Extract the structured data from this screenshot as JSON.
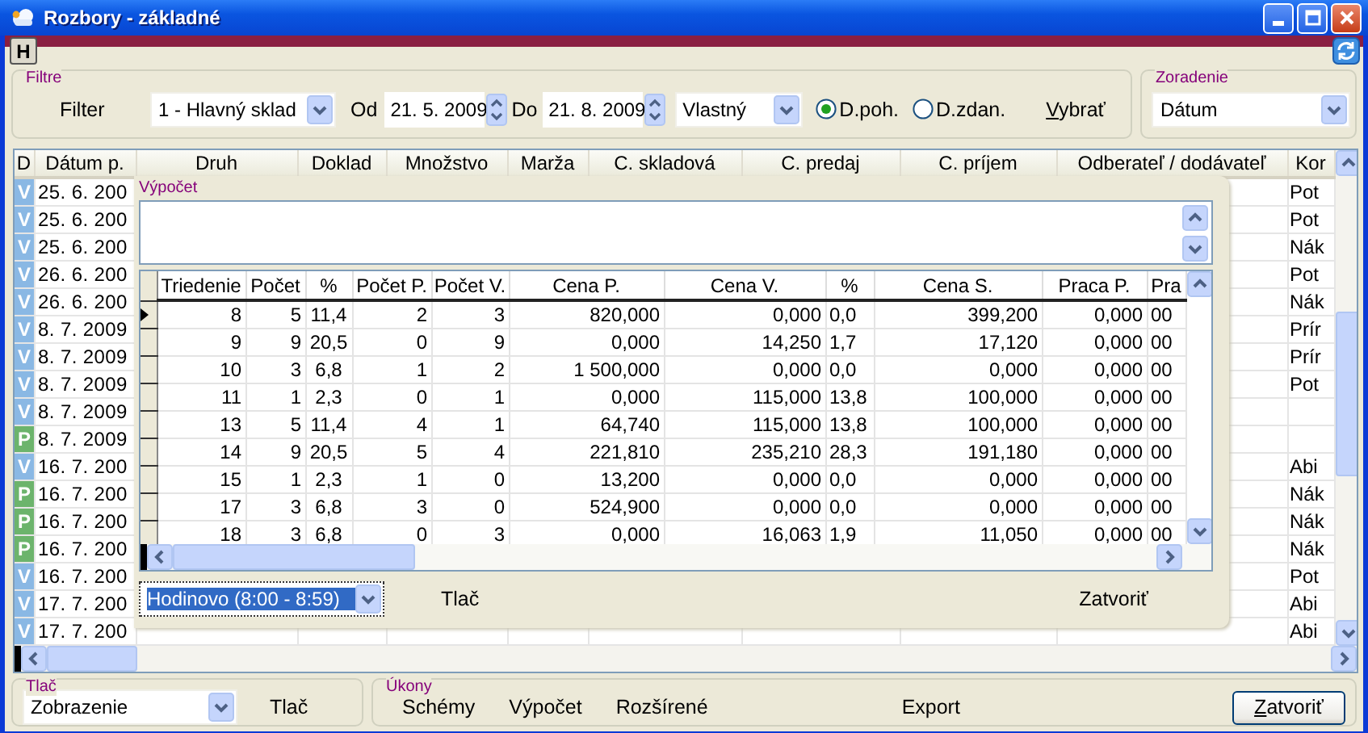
{
  "window": {
    "title": "Rozbory - základné"
  },
  "toolbar": {
    "button": "H"
  },
  "filter": {
    "group": "Filtre",
    "label": "Filter",
    "warehouse": "1 - Hlavný sklad",
    "from_label": "Od",
    "from": "21. 5. 2009",
    "to_label": "Do",
    "to": "21. 8. 2009",
    "period": "Vlastný",
    "date_options": [
      {
        "label": "D.poh.",
        "selected": true
      },
      {
        "label": "D.zdan.",
        "selected": false
      }
    ],
    "select_button": "Vybrať"
  },
  "sort": {
    "group": "Zoradenie",
    "value": "Dátum"
  },
  "grid": {
    "columns": [
      "D",
      "Dátum p.",
      "Druh",
      "Doklad",
      "Množstvo",
      "Marža",
      "C. skladová",
      "C. predaj",
      "C. príjem",
      "Odberateľ / dodávateľ",
      "Kor"
    ],
    "rows": [
      {
        "type": "V",
        "color": "#8ab8e4",
        "date": "25. 6. 200",
        "column_11": "Pot"
      },
      {
        "type": "V",
        "color": "#8ab8e4",
        "date": "25. 6. 200",
        "column_11": "Pot"
      },
      {
        "type": "V",
        "color": "#8ab8e4",
        "date": "25. 6. 200",
        "column_11": "Nák"
      },
      {
        "type": "V",
        "color": "#8ab8e4",
        "date": "26. 6. 200",
        "column_11": "Pot"
      },
      {
        "type": "V",
        "color": "#8ab8e4",
        "date": "26. 6. 200",
        "column_11": "Nák"
      },
      {
        "type": "V",
        "color": "#8ab8e4",
        "date": "8. 7. 2009",
        "column_11": "Prír"
      },
      {
        "type": "V",
        "color": "#8ab8e4",
        "date": "8. 7. 2009",
        "column_11": "Prír"
      },
      {
        "type": "V",
        "color": "#8ab8e4",
        "date": "8. 7. 2009",
        "column_11": "Pot"
      },
      {
        "type": "V",
        "color": "#8ab8e4",
        "date": "8. 7. 2009"
      },
      {
        "type": "P",
        "color": "#6cb46c",
        "date": "8. 7. 2009"
      },
      {
        "type": "V",
        "color": "#8ab8e4",
        "date": "16. 7. 200",
        "column_11": "Abi"
      },
      {
        "type": "P",
        "color": "#6cb46c",
        "date": "16. 7. 200",
        "column_11": "Nák"
      },
      {
        "type": "P",
        "color": "#6cb46c",
        "date": "16. 7. 200",
        "column_11": "Nák"
      },
      {
        "type": "P",
        "color": "#6cb46c",
        "date": "16. 7. 200",
        "column_11": "Nák"
      },
      {
        "type": "V",
        "color": "#8ab8e4",
        "date": "16. 7. 200",
        "column_11": "Pot"
      },
      {
        "type": "V",
        "color": "#8ab8e4",
        "date": "17. 7. 200",
        "column_11": "Abi"
      },
      {
        "type": "V",
        "color": "#8ab8e4",
        "date": "17. 7. 200",
        "column_11": "Abi"
      }
    ]
  },
  "calc": {
    "title": "Výpočet",
    "columns": [
      "Triedenie",
      "Počet",
      "%",
      "Počet P.",
      "Počet V.",
      "Cena P.",
      "Cena V.",
      "%",
      "Cena S.",
      "Praca P.",
      "Pra"
    ],
    "rows": [
      {
        "current": true,
        "cells": [
          "8",
          "5",
          "11,4",
          "2",
          "3",
          "820,000",
          "0,000",
          "0,0",
          "399,200",
          "0,000",
          "00"
        ]
      },
      {
        "current": false,
        "cells": [
          "9",
          "9",
          "20,5",
          "0",
          "9",
          "0,000",
          "14,250",
          "1,7",
          "17,120",
          "0,000",
          "00"
        ]
      },
      {
        "current": false,
        "cells": [
          "10",
          "3",
          "6,8",
          "1",
          "2",
          "1 500,000",
          "0,000",
          "0,0",
          "0,000",
          "0,000",
          "00"
        ]
      },
      {
        "current": false,
        "cells": [
          "11",
          "1",
          "2,3",
          "0",
          "1",
          "0,000",
          "115,000",
          "13,8",
          "100,000",
          "0,000",
          "00"
        ]
      },
      {
        "current": false,
        "cells": [
          "13",
          "5",
          "11,4",
          "4",
          "1",
          "64,740",
          "115,000",
          "13,8",
          "100,000",
          "0,000",
          "00"
        ]
      },
      {
        "current": false,
        "cells": [
          "14",
          "9",
          "20,5",
          "5",
          "4",
          "221,810",
          "235,210",
          "28,3",
          "191,180",
          "0,000",
          "00"
        ]
      },
      {
        "current": false,
        "cells": [
          "15",
          "1",
          "2,3",
          "1",
          "0",
          "13,200",
          "0,000",
          "0,0",
          "0,000",
          "0,000",
          "00"
        ]
      },
      {
        "current": false,
        "cells": [
          "17",
          "3",
          "6,8",
          "3",
          "0",
          "524,900",
          "0,000",
          "0,0",
          "0,000",
          "0,000",
          "00"
        ]
      },
      {
        "current": false,
        "cells": [
          "18",
          "3",
          "6,8",
          "0",
          "3",
          "0,000",
          "16,063",
          "1,9",
          "11,050",
          "0,000",
          "00"
        ]
      }
    ],
    "grouping": "Hodinovo (8:00 - 8:59)",
    "print_button": "Tlač",
    "close_button": "Zatvoriť"
  },
  "print": {
    "group": "Tlač",
    "value": "Zobrazenie",
    "button": "Tlač"
  },
  "actions": {
    "group": "Úkony",
    "buttons": [
      "Schémy",
      "Výpočet",
      "Rozšírené",
      "Export"
    ]
  },
  "close_button": "Zatvoriť"
}
